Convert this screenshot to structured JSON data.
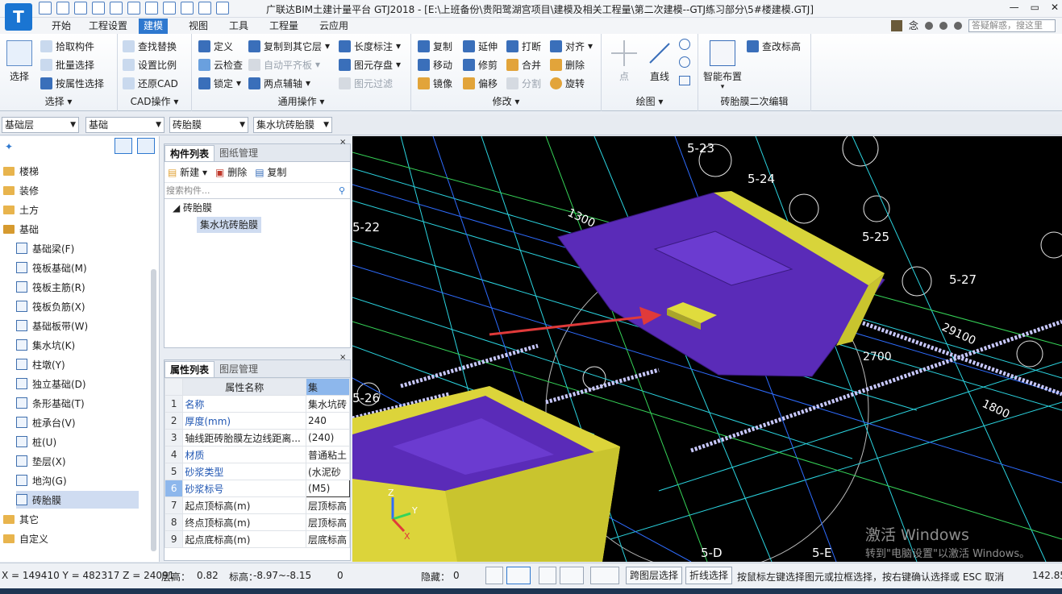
{
  "window": {
    "title": "广联达BIM土建计量平台 GTJ2018 - [E:\\上班备份\\贵阳鹭湖宫项目\\建模及相关工程量\\第二次建模--GTJ练习部分\\5#楼建模.GTJ]",
    "logo_letter": "T",
    "controls": [
      "—",
      "▭",
      "✕"
    ]
  },
  "menu": {
    "tabs": [
      "开始",
      "工程设置",
      "建模",
      "视图",
      "工具",
      "工程量",
      "云应用"
    ],
    "active": "建模",
    "user": "念",
    "search_placeholder": "答疑解惑，搜这里"
  },
  "ribbon": {
    "select": {
      "big": "选择",
      "items": [
        "拾取构件",
        "批量选择",
        "按属性选择"
      ],
      "label": "选择"
    },
    "cad": {
      "items": [
        "查找替换",
        "设置比例",
        "还原CAD"
      ],
      "label": "CAD操作"
    },
    "general": {
      "col1": [
        "定义",
        "云检查",
        "锁定"
      ],
      "col2": [
        "复制到其它层",
        "自动平齐板",
        "两点辅轴"
      ],
      "col3": [
        "长度标注",
        "图元存盘",
        "图元过滤"
      ],
      "label": "通用操作"
    },
    "modify": {
      "col1": [
        "复制",
        "移动",
        "镜像"
      ],
      "col2": [
        "延伸",
        "修剪",
        "偏移"
      ],
      "col3": [
        "打断",
        "合并",
        "分割"
      ],
      "col4": [
        "对齐",
        "删除",
        "旋转"
      ],
      "label": "修改"
    },
    "draw": {
      "point": "点",
      "line": "直线",
      "label": "绘图"
    },
    "secondary": {
      "smart": "智能布置",
      "edit_elev": "查改标高",
      "label": "砖胎膜二次编辑"
    }
  },
  "filters": [
    "基础层",
    "基础",
    "砖胎膜",
    "集水坑砖胎膜"
  ],
  "tree": {
    "categories_top": [
      "楼梯",
      "装修",
      "土方",
      "基础"
    ],
    "base_children": [
      "基础梁(F)",
      "筏板基础(M)",
      "筏板主筋(R)",
      "筏板负筋(X)",
      "基础板带(W)",
      "集水坑(K)",
      "柱墩(Y)",
      "独立基础(D)",
      "条形基础(T)",
      "桩承台(V)",
      "桩(U)",
      "垫层(X)",
      "地沟(G)",
      "砖胎膜"
    ],
    "selected": "砖胎膜",
    "categories_bottom": [
      "其它",
      "自定义"
    ]
  },
  "component_panel": {
    "tabs": [
      "构件列表",
      "图纸管理"
    ],
    "tools": [
      "新建",
      "删除",
      "复制"
    ],
    "search_placeholder": "搜索构件...",
    "group": "砖胎膜",
    "item": "集水坑砖胎膜"
  },
  "property_panel": {
    "tabs": [
      "属性列表",
      "图层管理"
    ],
    "header": [
      "属性名称",
      "集"
    ],
    "rows": [
      {
        "no": "1",
        "name": "名称",
        "value": "集水坑砖"
      },
      {
        "no": "2",
        "name": "厚度(mm)",
        "value": "240"
      },
      {
        "no": "3",
        "name": "轴线距砖胎膜左边线距离...",
        "value": "(240)"
      },
      {
        "no": "4",
        "name": "材质",
        "value": "普通粘土"
      },
      {
        "no": "5",
        "name": "砂浆类型",
        "value": "(水泥砂"
      },
      {
        "no": "6",
        "name": "砂浆标号",
        "value": "(M5)"
      },
      {
        "no": "7",
        "name": "起点顶标高(m)",
        "value": "层顶标高"
      },
      {
        "no": "8",
        "name": "终点顶标高(m)",
        "value": "层顶标高"
      },
      {
        "no": "9",
        "name": "起点底标高(m)",
        "value": "层底标高"
      }
    ]
  },
  "viewport": {
    "grid_labels": [
      "5-23",
      "5-24",
      "5-22",
      "5-25",
      "5-27",
      "5-26",
      "5-D",
      "5-E"
    ],
    "dims": [
      "1300",
      "2700",
      "29100",
      "1800",
      "2700",
      "1300"
    ],
    "watermark_line1": "激活 Windows",
    "watermark_line2": "转到\"电脑设置\"以激活 Windows。",
    "axis": [
      "X",
      "Y",
      "Z"
    ]
  },
  "status": {
    "coords": "X = 149410 Y = 482317 Z = 24091",
    "layer_height_label": "层高：",
    "layer_height": "0.82",
    "elev_label": "标高：",
    "elev": "-8.97~-8.15",
    "zero": "0",
    "hidden_label": "隐藏：",
    "hidden": "0",
    "btn_cross_layer": "跨图层选择",
    "btn_polyline": "折线选择",
    "hint": "按鼠标左键选择图元或拉框选择，按右键确认选择或 ESC 取消",
    "right_value": "142.85"
  },
  "colors": {
    "accent": "#2e78cf",
    "selected_row": "#cfdcf1",
    "viewport_bg": "#000000",
    "pit_fill": "#5a2bb8",
    "pit_edge": "#d8d43a",
    "arrow": "#e03a3a"
  }
}
